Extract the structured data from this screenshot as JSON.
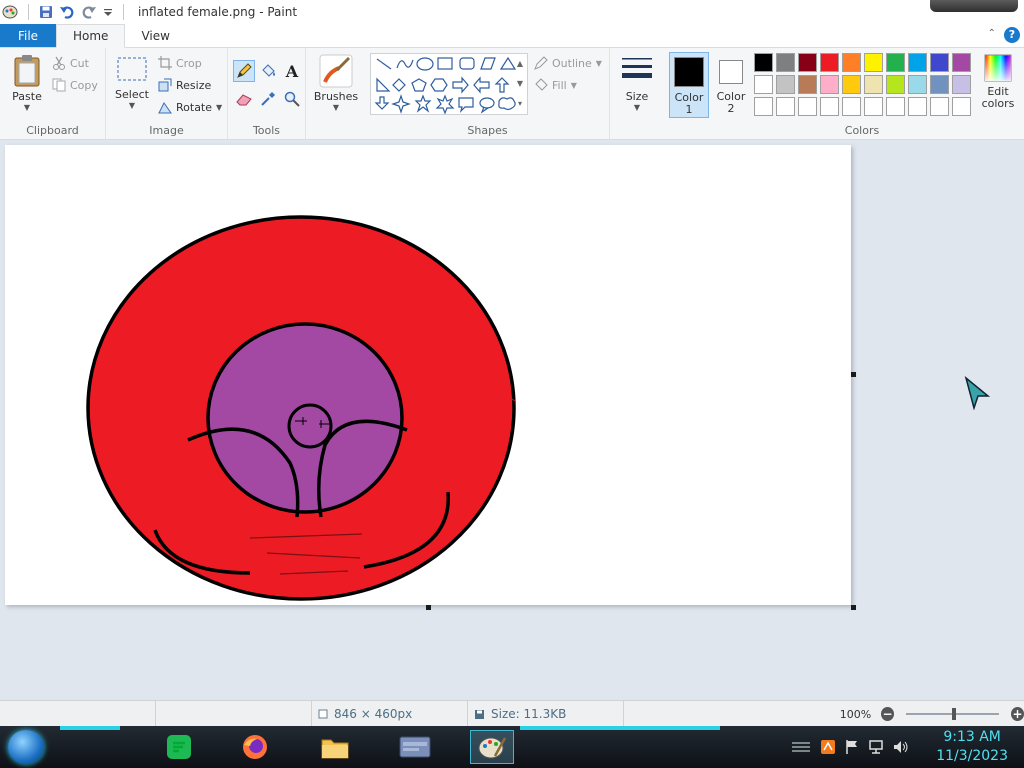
{
  "window": {
    "title": "inflated female.png - Paint"
  },
  "tabs": {
    "file": "File",
    "home": "Home",
    "view": "View"
  },
  "clipboard": {
    "paste": "Paste",
    "cut": "Cut",
    "copy": "Copy",
    "label": "Clipboard"
  },
  "image": {
    "select": "Select",
    "crop": "Crop",
    "resize": "Resize",
    "rotate": "Rotate",
    "label": "Image"
  },
  "tools": {
    "label": "Tools",
    "text_tool": "A"
  },
  "brushes": {
    "label": "Brushes"
  },
  "shapes": {
    "outline": "Outline",
    "fill": "Fill",
    "label": "Shapes"
  },
  "size": {
    "label": "Size"
  },
  "color1": {
    "label_line1": "Color",
    "label_line2": "1",
    "value": "#000000"
  },
  "color2": {
    "label_line1": "Color",
    "label_line2": "2",
    "value": "#ffffff"
  },
  "colors": {
    "label": "Colors",
    "edit_line1": "Edit",
    "edit_line2": "colors",
    "palette_row1": [
      "#000000",
      "#7f7f7f",
      "#880015",
      "#ed1c24",
      "#ff7f27",
      "#fff200",
      "#22b14c",
      "#00a2e8",
      "#3f48cc",
      "#a349a4"
    ],
    "palette_row2": [
      "#ffffff",
      "#c3c3c3",
      "#b97a57",
      "#ffaec9",
      "#ffc90e",
      "#efe4b0",
      "#b5e61d",
      "#99d9ea",
      "#7092be",
      "#c8bfe7"
    ]
  },
  "status": {
    "dimensions": "846 × 460px",
    "size": "Size: 11.3KB",
    "zoom": "100%"
  },
  "clock": {
    "time": "9:13 AM",
    "date": "11/3/2023"
  }
}
